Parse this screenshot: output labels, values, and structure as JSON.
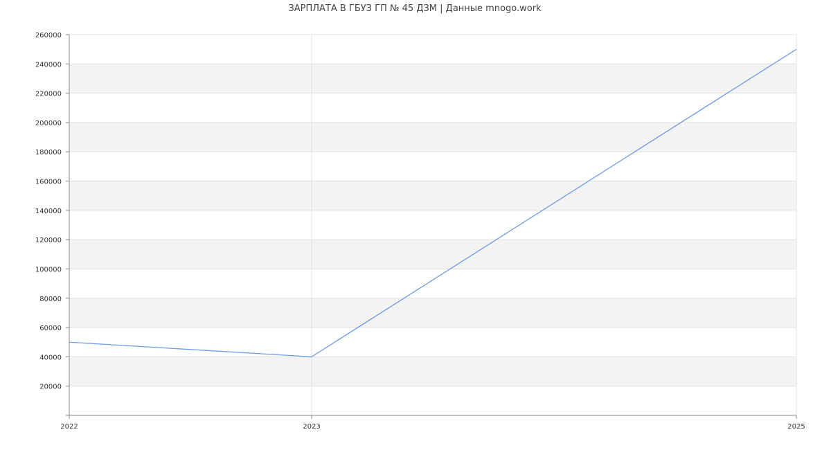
{
  "chart_data": {
    "type": "line",
    "title": "ЗАРПЛАТА В ГБУЗ ГП № 45 ДЗМ | Данные mnogo.work",
    "xlabel": "",
    "ylabel": "",
    "x": [
      2022,
      2023,
      2025
    ],
    "x_tick_labels": [
      "2022",
      "2023",
      "2025"
    ],
    "xlim": [
      2022,
      2025
    ],
    "ylim": [
      0,
      260000
    ],
    "y_ticks": [
      20000,
      40000,
      60000,
      80000,
      100000,
      120000,
      140000,
      160000,
      180000,
      200000,
      220000,
      240000,
      260000
    ],
    "y_tick_labels": [
      "20000",
      "40000",
      "60000",
      "80000",
      "100000",
      "120000",
      "140000",
      "160000",
      "180000",
      "200000",
      "220000",
      "240000",
      "260000"
    ],
    "series": [
      {
        "values": [
          50000,
          40000,
          250000
        ],
        "color": "#6a9be6"
      }
    ],
    "grid": true,
    "band_color": "#f3f3f3",
    "grid_color": "#e2e2e2",
    "axis_color": "#888888"
  }
}
